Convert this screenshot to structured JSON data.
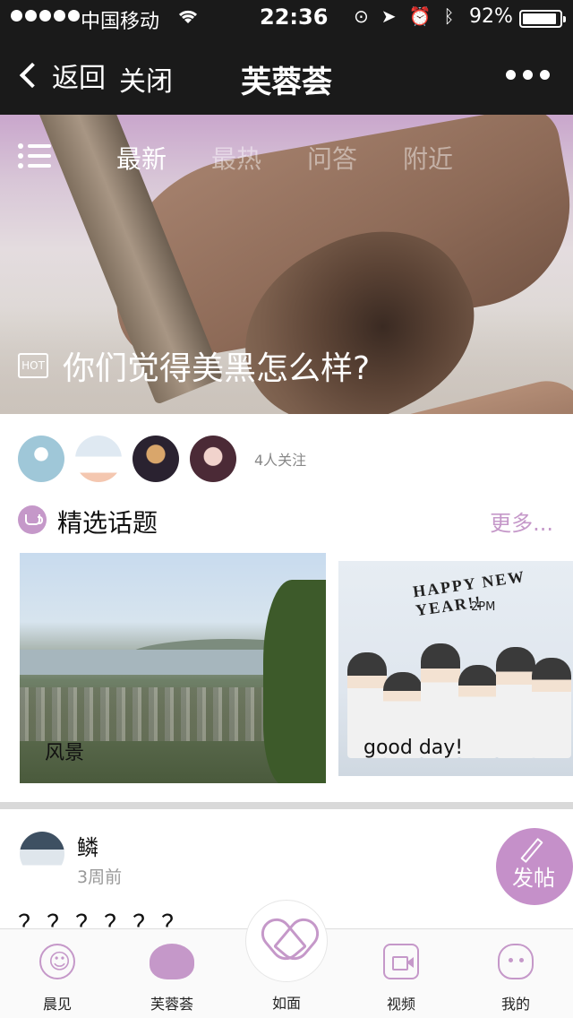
{
  "status_bar": {
    "carrier": "中国移动",
    "time": "22:36",
    "battery_percent": "92%",
    "battery_level": 0.92
  },
  "nav": {
    "back_label": "返回",
    "close_label": "关闭",
    "title": "芙蓉荟"
  },
  "hero": {
    "tabs": [
      {
        "label": "最新",
        "active": true
      },
      {
        "label": "最热",
        "active": false
      },
      {
        "label": "问答",
        "active": false
      },
      {
        "label": "附近",
        "active": false
      }
    ],
    "hot_badge": "HOT",
    "headline": "你们觉得美黑怎么样?"
  },
  "followers": {
    "count_text": "4人关注"
  },
  "featured": {
    "title": "精选话题",
    "more_label": "更多...",
    "cards": [
      {
        "label": "风景"
      },
      {
        "label": "good day!",
        "image_text": "HAPPY NEW YEAR!!",
        "image_subtext": "2PM"
      }
    ]
  },
  "post": {
    "author": "鳞",
    "time": "3周前",
    "body": "？？？？？？",
    "fab_label": "发帖"
  },
  "tab_bar": {
    "items": [
      {
        "label": "晨见",
        "icon": "smiley-flower-icon"
      },
      {
        "label": "芙蓉荟",
        "icon": "lotus-icon"
      },
      {
        "label": "如面",
        "icon": "heart-face-icon"
      },
      {
        "label": "视频",
        "icon": "video-icon"
      },
      {
        "label": "我的",
        "icon": "profile-icon"
      }
    ]
  },
  "colors": {
    "accent": "#c598c9",
    "dark_bar": "#1a1a1a"
  }
}
